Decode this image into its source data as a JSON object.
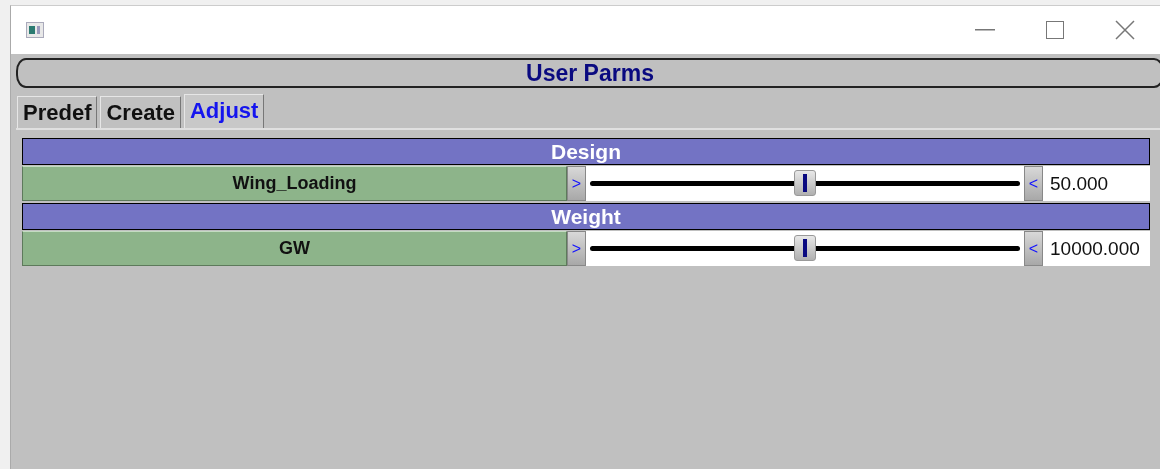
{
  "banner": {
    "title": "User Parms"
  },
  "tabs": [
    {
      "label": "Predef",
      "selected": false
    },
    {
      "label": "Create",
      "selected": false
    },
    {
      "label": "Adjust",
      "selected": true
    }
  ],
  "groups": [
    {
      "name": "Design",
      "params": [
        {
          "name": "Wing_Loading",
          "decrement": ">",
          "increment": "<",
          "level": 0.5,
          "value": "50.000"
        }
      ]
    },
    {
      "name": "Weight",
      "params": [
        {
          "name": "GW",
          "decrement": ">",
          "increment": "<",
          "level": 0.5,
          "value": "10000.000"
        }
      ]
    }
  ]
}
